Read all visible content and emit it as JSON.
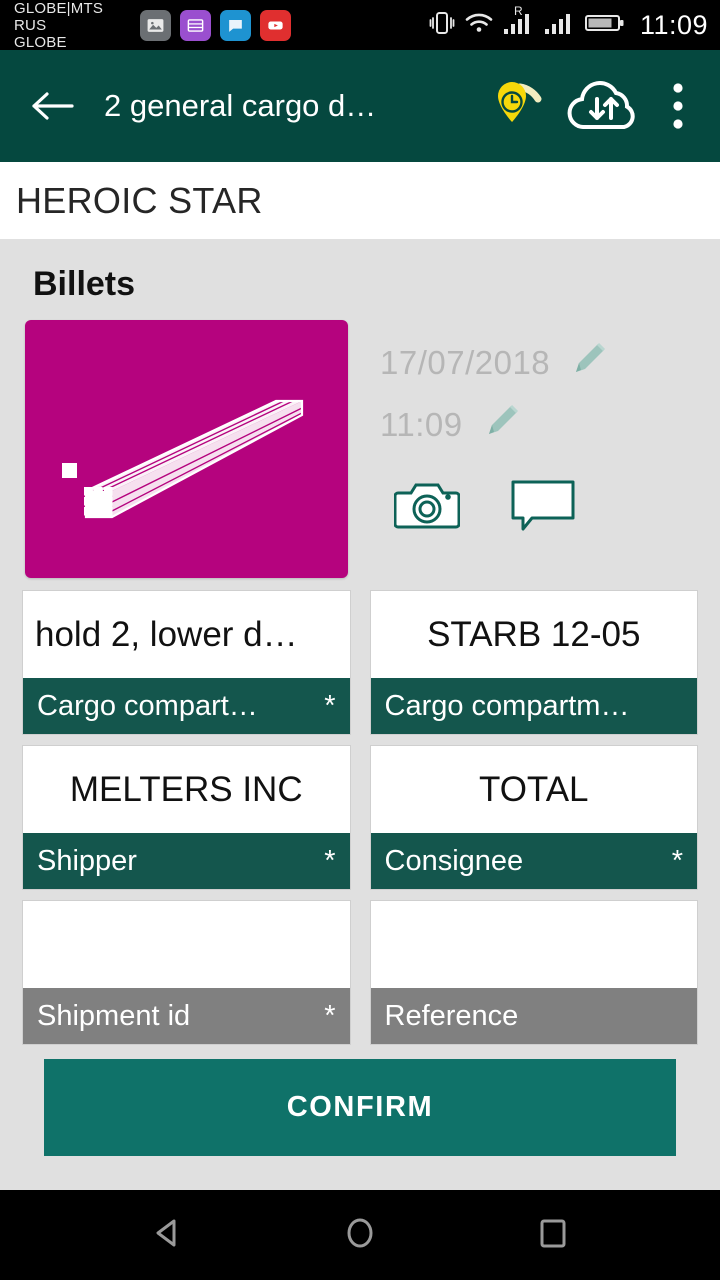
{
  "statusbar": {
    "carrier": "GLOBE|MTS RUS\nGLOBE",
    "time": "11:09",
    "icons": [
      "gallery-icon",
      "keyboard-icon",
      "chat-icon",
      "youtube-icon",
      "vibrate-icon",
      "wifi-icon",
      "signal-roaming-icon",
      "signal-icon",
      "battery-icon"
    ],
    "roaming_label": "R"
  },
  "appbar": {
    "title": "2 general cargo d…",
    "back_icon": "back-arrow-icon",
    "gps_icon": "gps-pin-clock-icon",
    "sync_icon": "cloud-sync-icon",
    "overflow_icon": "overflow-menu-icon"
  },
  "vessel": {
    "name": "HEROIC STAR"
  },
  "cargo": {
    "section_title": "Billets",
    "card_color": "#b5037e",
    "card_icon": "billets-bundle-icon",
    "date": "17/07/2018",
    "time": "11:09",
    "edit_date_icon": "pencil-icon",
    "edit_time_icon": "pencil-icon",
    "camera_icon": "camera-icon",
    "comment_icon": "comment-icon"
  },
  "fields": [
    [
      {
        "value": "hold 2, lower d…",
        "label": "Cargo compart…",
        "required": "*",
        "label_style": "teal",
        "align": "left"
      },
      {
        "value": "STARB 12-05",
        "label": "Cargo compartm…",
        "required": "",
        "label_style": "teal",
        "align": "center"
      }
    ],
    [
      {
        "value": "MELTERS INC",
        "label": "Shipper",
        "required": "*",
        "label_style": "teal",
        "align": "center"
      },
      {
        "value": "TOTAL",
        "label": "Consignee",
        "required": "*",
        "label_style": "teal",
        "align": "center"
      }
    ],
    [
      {
        "value": "",
        "label": "Shipment id",
        "required": "*",
        "label_style": "gray",
        "align": "center"
      },
      {
        "value": "",
        "label": "Reference",
        "required": "",
        "label_style": "gray",
        "align": "center"
      }
    ]
  ],
  "confirm": {
    "label": "CONFIRM",
    "color": "#0f7269"
  },
  "navbar": {
    "back_icon": "nav-back-icon",
    "home_icon": "nav-home-icon",
    "recents_icon": "nav-recents-icon"
  }
}
